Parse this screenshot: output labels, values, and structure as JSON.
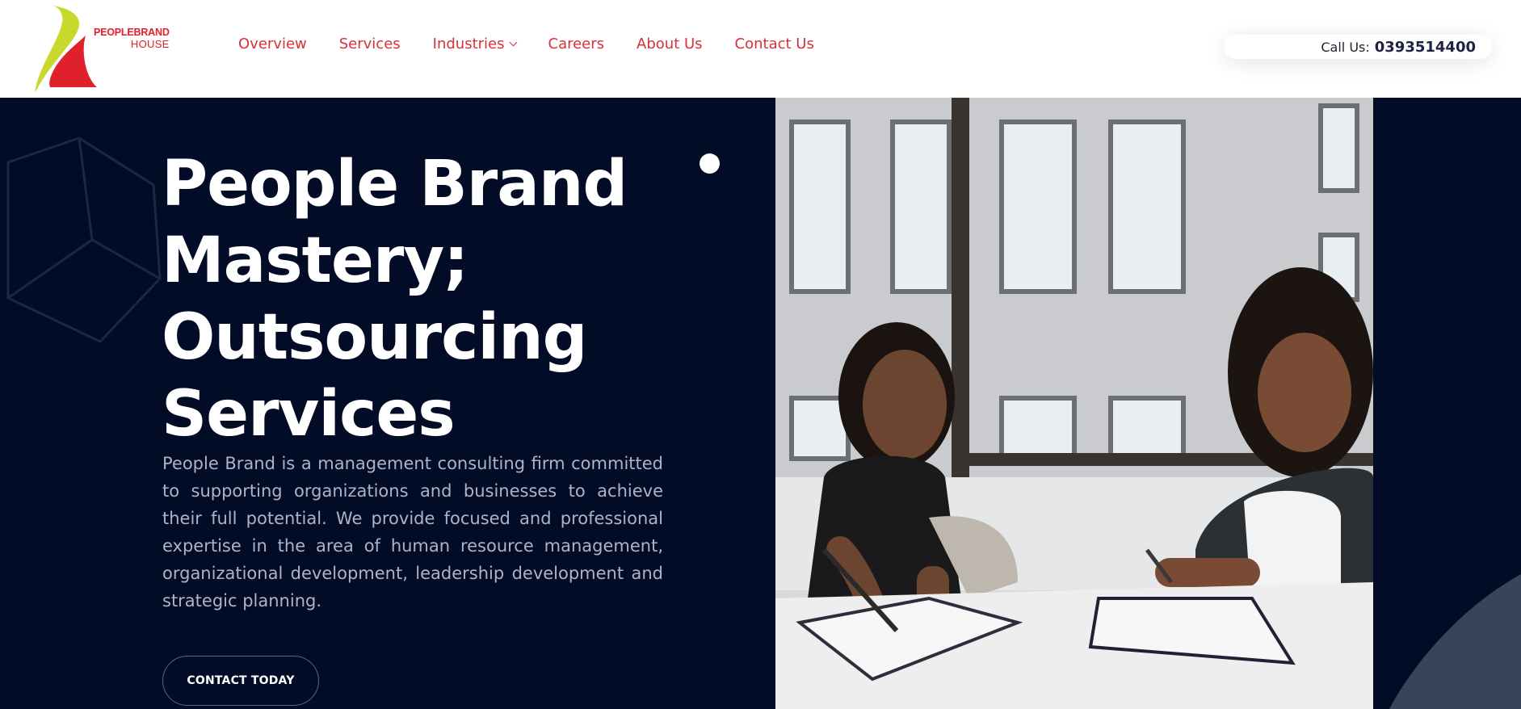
{
  "brand": {
    "line1": "PEOPLEBRAND",
    "line2": "HOUSE"
  },
  "nav": {
    "items": [
      {
        "label": "Overview"
      },
      {
        "label": "Services"
      },
      {
        "label": "Industries"
      },
      {
        "label": "Careers"
      },
      {
        "label": "About Us"
      },
      {
        "label": "Contact Us"
      }
    ]
  },
  "call": {
    "label": "Call Us:",
    "number": "0393514400"
  },
  "hero": {
    "title_lines": [
      "People Brand",
      "Mastery;",
      "Outsourcing",
      "Services"
    ],
    "description": "People Brand is a management consulting firm committed to supporting organizations and businesses to achieve their full potential. We provide focused and professional expertise in the area of human resource management, organizational development, leadership development and strategic planning.",
    "cta_label": "CONTACT TODAY"
  },
  "colors": {
    "hero_background": "#030c27",
    "nav_text": "#d6303a",
    "logo_red": "#e0202a",
    "logo_green": "#c9d82c",
    "accent_slate": "#3a4459"
  },
  "icons": {
    "logo": "peoplebrand-swoosh-logo",
    "dropdown": "chevron-down-icon",
    "decoration": "outline-cube-icon"
  }
}
